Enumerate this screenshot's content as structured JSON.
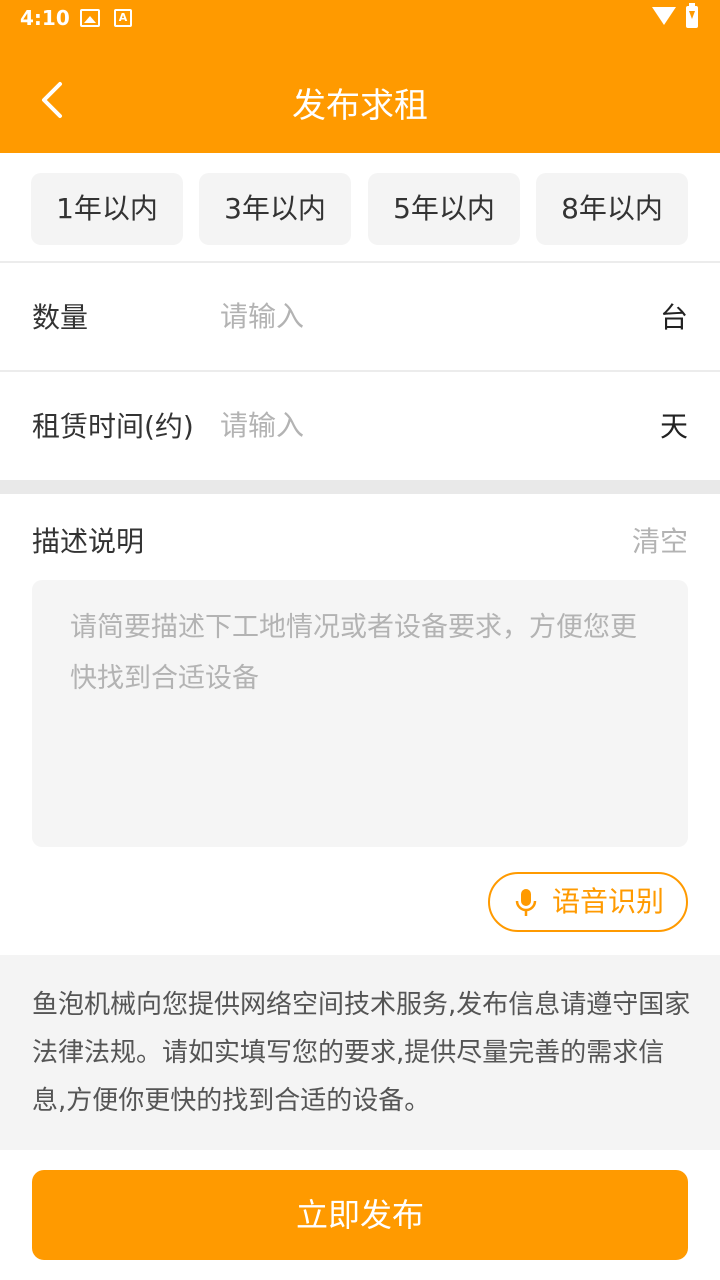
{
  "status_bar": {
    "time": "4:10",
    "a_icon": "A"
  },
  "header": {
    "title": "发布求租",
    "back_icon": "chevron-left-icon"
  },
  "chips": [
    {
      "label": "1年以内"
    },
    {
      "label": "3年以内"
    },
    {
      "label": "5年以内"
    },
    {
      "label": "8年以内"
    }
  ],
  "form": {
    "quantity": {
      "label": "数量",
      "placeholder": "请输入",
      "value": "",
      "unit": "台"
    },
    "rent_time": {
      "label": "租赁时间(约)",
      "placeholder": "请输入",
      "value": "",
      "unit": "天"
    }
  },
  "description": {
    "title": "描述说明",
    "clear_label": "清空",
    "placeholder": "请简要描述下工地情况或者设备要求，方便您更快找到合适设备",
    "value": ""
  },
  "voice": {
    "label": "语音识别",
    "icon": "microphone-icon"
  },
  "notice": {
    "text": "鱼泡机械向您提供网络空间技术服务,发布信息请遵守国家法律法规。请如实填写您的要求,提供尽量完善的需求信息,方便你更快的找到合适的设备。"
  },
  "publish": {
    "label": "立即发布"
  },
  "colors": {
    "accent": "#ff9a00",
    "background": "#ffffff",
    "panel": "#f4f4f4"
  }
}
